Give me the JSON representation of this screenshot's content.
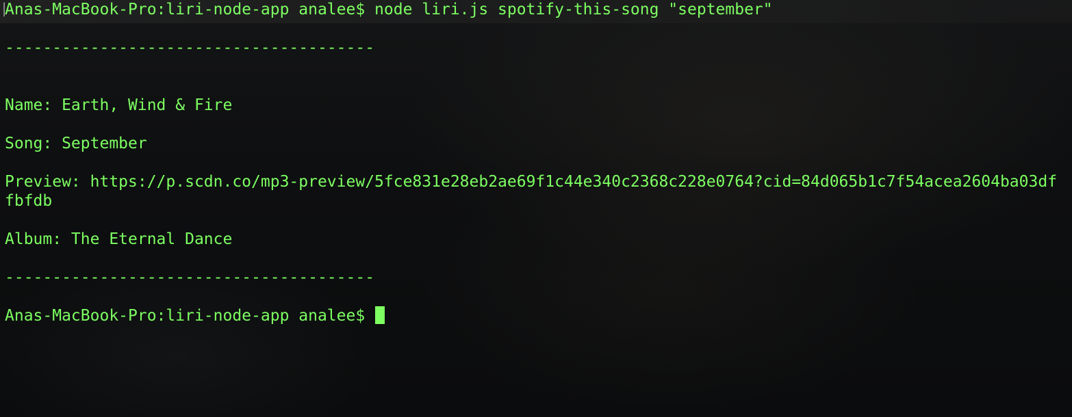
{
  "terminal": {
    "prompt_cmd": "Anas-MacBook-Pro:liri-node-app analee$ node liri.js spotify-this-song \"september\"",
    "separator_top": "---------------------------------------",
    "name": "Name: Earth, Wind & Fire",
    "song": "Song: September",
    "preview_line1": "Preview: https://p.scdn.co/mp3-preview/5fce831e28eb2ae69f1c44e340c2368c228e0764?cid=84d065b1c7f54acea2604ba03df",
    "preview_line2": "fbfdb",
    "album": "Album: The Eternal Dance",
    "separator_bottom": "---------------------------------------",
    "prompt": "Anas-MacBook-Pro:liri-node-app analee$ "
  },
  "colors": {
    "text": "#7dff62",
    "background": "#0d0e0f"
  }
}
